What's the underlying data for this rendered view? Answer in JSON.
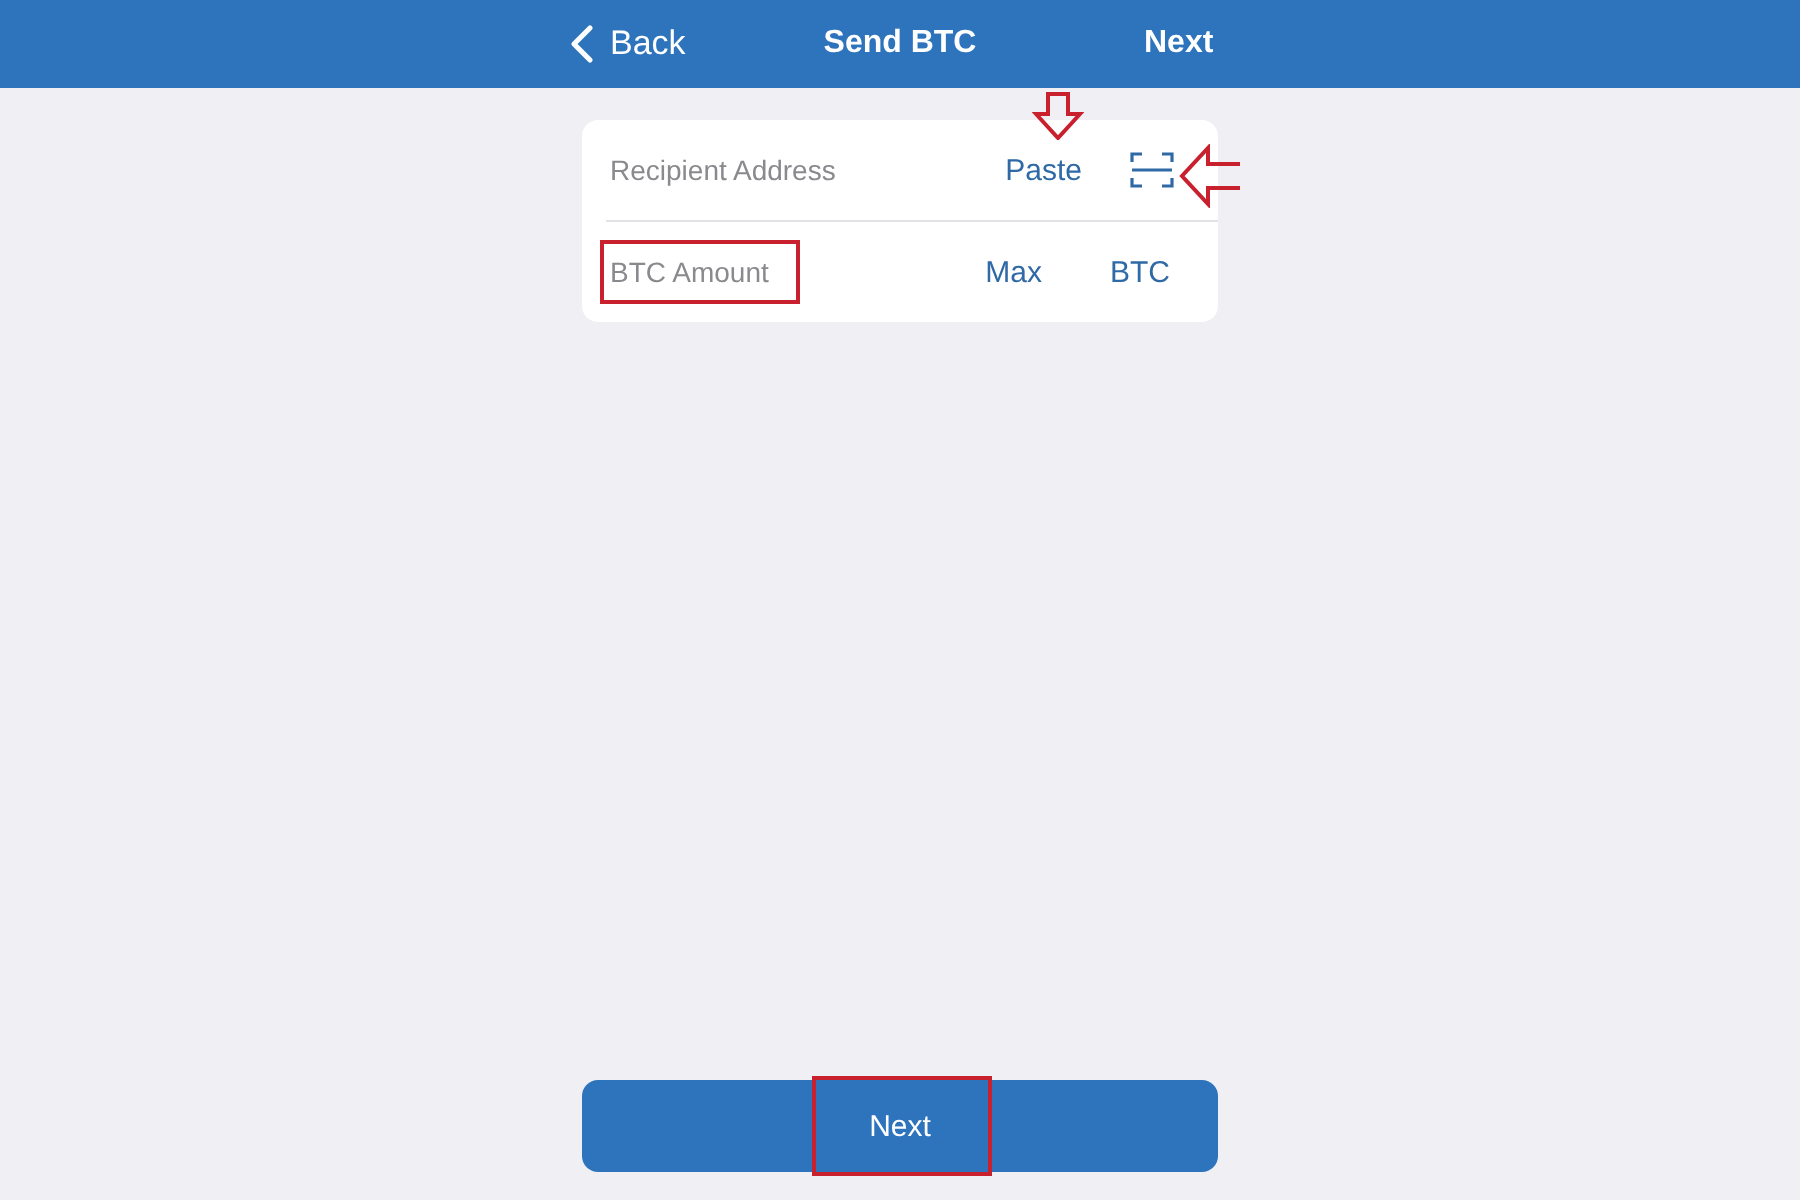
{
  "nav_bar": {
    "back": "Back",
    "title": "Send BTC",
    "next": "Next"
  },
  "form": {
    "address": {
      "placeholder": "Recipient Address",
      "paste": "Paste"
    },
    "amount": {
      "placeholder": "BTC Amount",
      "max": "Max",
      "unit": "BTC"
    }
  },
  "next_button": "Next"
}
